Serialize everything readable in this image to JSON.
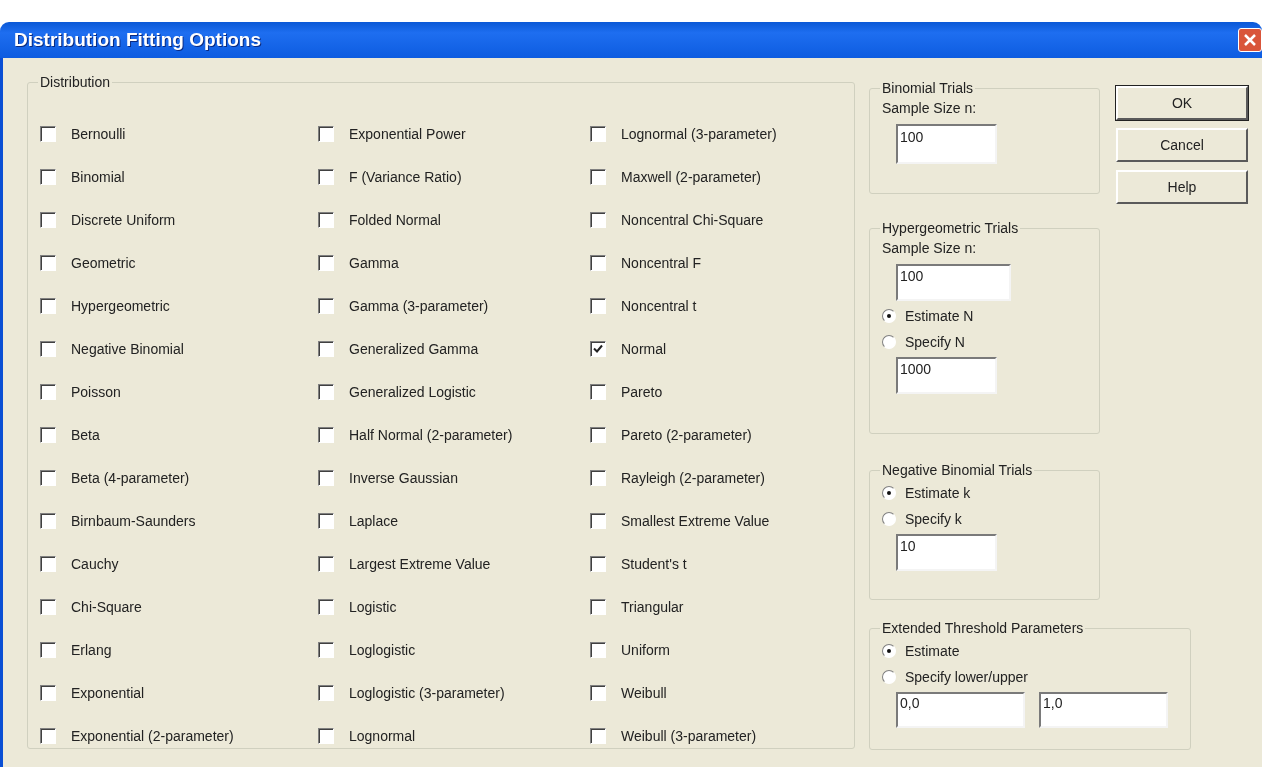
{
  "window": {
    "title": "Distribution Fitting Options"
  },
  "distribution": {
    "label": "Distribution",
    "columns": [
      [
        {
          "label": "Bernoulli",
          "checked": false
        },
        {
          "label": "Binomial",
          "checked": false
        },
        {
          "label": "Discrete Uniform",
          "checked": false
        },
        {
          "label": "Geometric",
          "checked": false
        },
        {
          "label": "Hypergeometric",
          "checked": false
        },
        {
          "label": "Negative Binomial",
          "checked": false
        },
        {
          "label": "Poisson",
          "checked": false
        },
        {
          "label": "Beta",
          "checked": false
        },
        {
          "label": "Beta (4-parameter)",
          "checked": false
        },
        {
          "label": "Birnbaum-Saunders",
          "checked": false
        },
        {
          "label": "Cauchy",
          "checked": false
        },
        {
          "label": "Chi-Square",
          "checked": false
        },
        {
          "label": "Erlang",
          "checked": false
        },
        {
          "label": "Exponential",
          "checked": false
        },
        {
          "label": "Exponential (2-parameter)",
          "checked": false
        }
      ],
      [
        {
          "label": "Exponential Power",
          "checked": false
        },
        {
          "label": "F (Variance Ratio)",
          "checked": false
        },
        {
          "label": "Folded Normal",
          "checked": false
        },
        {
          "label": "Gamma",
          "checked": false
        },
        {
          "label": "Gamma (3-parameter)",
          "checked": false
        },
        {
          "label": "Generalized Gamma",
          "checked": false
        },
        {
          "label": "Generalized Logistic",
          "checked": false
        },
        {
          "label": "Half Normal (2-parameter)",
          "checked": false
        },
        {
          "label": "Inverse Gaussian",
          "checked": false
        },
        {
          "label": "Laplace",
          "checked": false
        },
        {
          "label": "Largest Extreme Value",
          "checked": false
        },
        {
          "label": "Logistic",
          "checked": false
        },
        {
          "label": "Loglogistic",
          "checked": false
        },
        {
          "label": "Loglogistic (3-parameter)",
          "checked": false
        },
        {
          "label": "Lognormal",
          "checked": false
        }
      ],
      [
        {
          "label": "Lognormal (3-parameter)",
          "checked": false
        },
        {
          "label": "Maxwell (2-parameter)",
          "checked": false
        },
        {
          "label": "Noncentral Chi-Square",
          "checked": false
        },
        {
          "label": "Noncentral F",
          "checked": false
        },
        {
          "label": "Noncentral t",
          "checked": false
        },
        {
          "label": "Normal",
          "checked": true
        },
        {
          "label": "Pareto",
          "checked": false
        },
        {
          "label": "Pareto (2-parameter)",
          "checked": false
        },
        {
          "label": "Rayleigh (2-parameter)",
          "checked": false
        },
        {
          "label": "Smallest Extreme Value",
          "checked": false
        },
        {
          "label": "Student's t",
          "checked": false
        },
        {
          "label": "Triangular",
          "checked": false
        },
        {
          "label": "Uniform",
          "checked": false
        },
        {
          "label": "Weibull",
          "checked": false
        },
        {
          "label": "Weibull (3-parameter)",
          "checked": false
        }
      ]
    ]
  },
  "binomial_trials": {
    "label": "Binomial Trials",
    "field_label": "Sample Size n:",
    "sample_size": "100"
  },
  "hypergeometric_trials": {
    "label": "Hypergeometric Trials",
    "field_label": "Sample Size n:",
    "sample_size": "100",
    "options": [
      {
        "label": "Estimate N",
        "selected": true
      },
      {
        "label": "Specify N",
        "selected": false
      }
    ],
    "n_value": "1000"
  },
  "negative_binomial_trials": {
    "label": "Negative Binomial Trials",
    "options": [
      {
        "label": "Estimate k",
        "selected": true
      },
      {
        "label": "Specify k",
        "selected": false
      }
    ],
    "k_value": "10"
  },
  "extended_threshold_parameters": {
    "label": "Extended Threshold Parameters",
    "options": [
      {
        "label": "Estimate",
        "selected": true
      },
      {
        "label": "Specify lower/upper",
        "selected": false
      }
    ],
    "lower": "0,0",
    "upper": "1,0"
  },
  "buttons": [
    {
      "label": "OK",
      "default": true
    },
    {
      "label": "Cancel",
      "default": false
    },
    {
      "label": "Help",
      "default": false
    }
  ]
}
